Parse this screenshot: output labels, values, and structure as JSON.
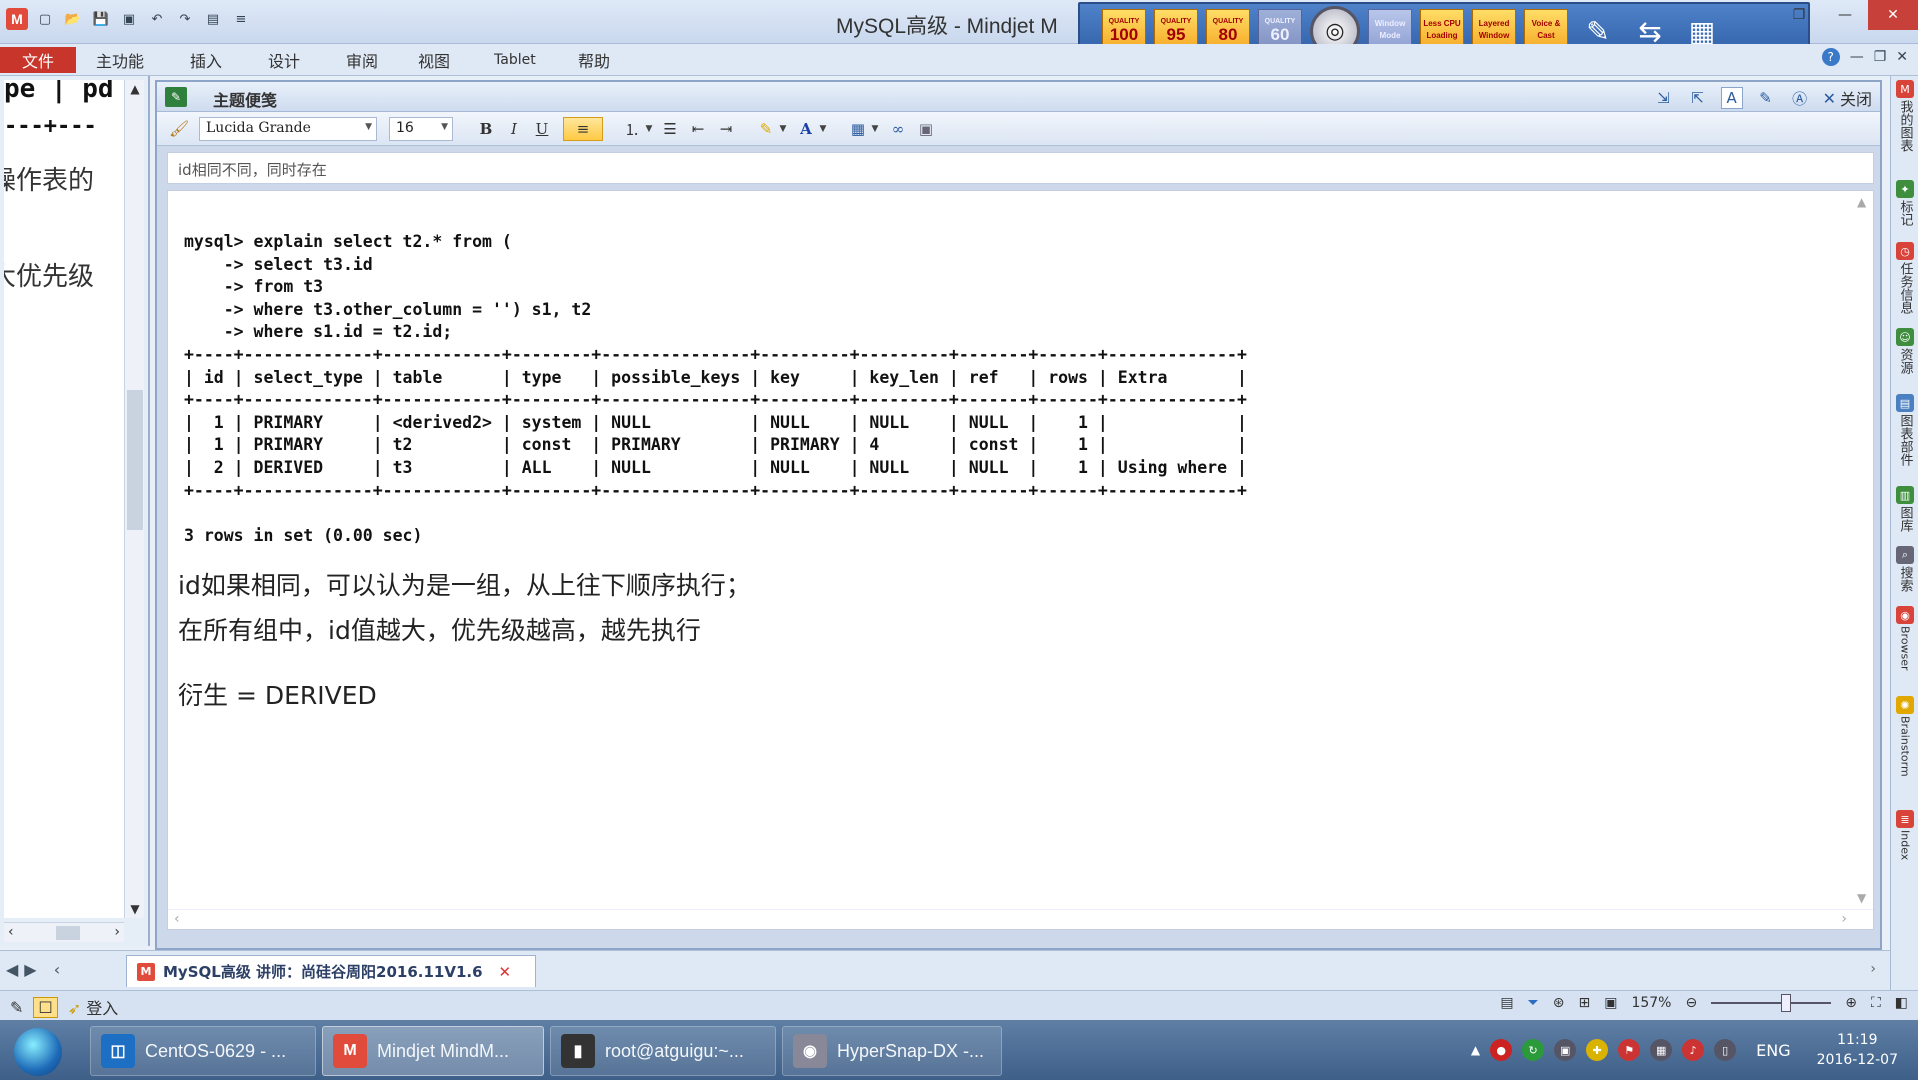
{
  "window": {
    "title": "MySQL高级 - Mindjet M",
    "app_icon_text": "M",
    "restore_glyph": "❐",
    "minimize_glyph": "—",
    "close_glyph": "✕"
  },
  "capture_toolbar": {
    "quality_label": "QUALITY",
    "quality_buttons": [
      "100",
      "95",
      "80",
      "60"
    ],
    "mode_buttons": [
      "Window Mode",
      "Less CPU Loading",
      "Layered Window",
      "Voice & Cast"
    ]
  },
  "ribbon": {
    "file_tab": "文件",
    "tabs": [
      "主功能",
      "插入",
      "设计",
      "审阅",
      "视图",
      "Tablet",
      "帮助"
    ],
    "help_glyph": "?"
  },
  "left_pane": {
    "line1": "pe | pd",
    "line2": "---+---",
    "text1": "操作表的",
    "text2": "大优先级"
  },
  "notes_panel": {
    "header_title": "主题便笺",
    "close_label": "关闭",
    "font_name": "Lucida Grande",
    "font_size": "16",
    "title_text": "id相同不同，同时存在"
  },
  "editor": {
    "mysql_output": "mysql> explain select t2.* from (\n    -> select t3.id\n    -> from t3\n    -> where t3.other_column = '') s1, t2\n    -> where s1.id = t2.id;\n+----+-------------+------------+--------+---------------+---------+---------+-------+------+-------------+\n| id | select_type | table      | type   | possible_keys | key     | key_len | ref   | rows | Extra       |\n+----+-------------+------------+--------+---------------+---------+---------+-------+------+-------------+\n|  1 | PRIMARY     | <derived2> | system | NULL          | NULL    | NULL    | NULL  |    1 |             |\n|  1 | PRIMARY     | t2         | const  | PRIMARY       | PRIMARY | 4       | const |    1 |             |\n|  2 | DERIVED     | t3         | ALL    | NULL          | NULL    | NULL    | NULL  |    1 | Using where |\n+----+-------------+------------+--------+---------------+---------+---------+-------+------+-------------+\n\n3 rows in set (0.00 sec)",
    "note1": "id如果相同，可以认为是一组，从上往下顺序执行；",
    "note2": "在所有组中，id值越大，优先级越高，越先执行",
    "note3": "衍生 = DERIVED"
  },
  "right_dock": [
    "我的图表",
    "标记",
    "任务信息",
    "资源",
    "图表部件",
    "图库",
    "搜索",
    "Browser",
    "Brainstorm",
    "Index"
  ],
  "document_tab": {
    "label": "MySQL高级 讲师：尚硅谷周阳2016.11V1.6",
    "close_glyph": "✕"
  },
  "statusbar": {
    "login_label": "登入",
    "zoom": "157%"
  },
  "taskbar": {
    "tasks": [
      "CentOS-0629 - ...",
      "Mindjet MindM...",
      "root@atguigu:~...",
      "HyperSnap-DX -..."
    ],
    "language": "ENG",
    "time": "11:19",
    "date": "2016-12-07"
  }
}
